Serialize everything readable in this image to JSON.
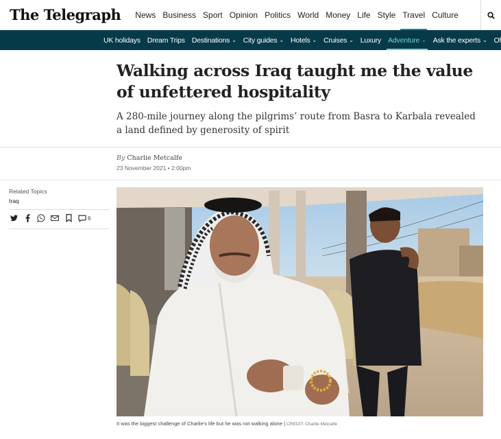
{
  "brand": {
    "logo": "The Telegraph",
    "accent": "#0a8a8a",
    "subnav_bg": "#073a48"
  },
  "main_nav": [
    {
      "label": "News"
    },
    {
      "label": "Business"
    },
    {
      "label": "Sport"
    },
    {
      "label": "Opinion"
    },
    {
      "label": "Politics"
    },
    {
      "label": "World"
    },
    {
      "label": "Money"
    },
    {
      "label": "Life"
    },
    {
      "label": "Style"
    },
    {
      "label": "Travel",
      "active": true
    },
    {
      "label": "Culture"
    }
  ],
  "search_icon": "search-icon",
  "sub_nav": [
    {
      "label": "UK holidays"
    },
    {
      "label": "Dream Trips"
    },
    {
      "label": "Destinations",
      "dropdown": true
    },
    {
      "label": "City guides",
      "dropdown": true
    },
    {
      "label": "Hotels",
      "dropdown": true
    },
    {
      "label": "Cruises",
      "dropdown": true
    },
    {
      "label": "Luxury"
    },
    {
      "label": "Adventure",
      "dropdown": true,
      "active": true
    },
    {
      "label": "Ask the experts",
      "dropdown": true
    },
    {
      "label": "Offers"
    }
  ],
  "article": {
    "headline": "Walking across Iraq taught me the value of unfettered hospitality",
    "standfirst": "A 280-mile journey along the pilgrims’ route from Basra to Karbala revealed a land defined by generosity of spirit",
    "byline_prefix": "By",
    "author": "Charlie Metcalfe",
    "date": "23 November 2021 • 2:00pm",
    "caption": "It was the biggest challenge of Charlie's life but he was not walking alone | ",
    "credit": "CREDIT: Charlie Metcalfe"
  },
  "sidebar": {
    "related_label": "Related Topics",
    "topic": "Iraq",
    "share_icons": [
      "twitter-icon",
      "facebook-icon",
      "whatsapp-icon",
      "email-icon",
      "bookmark-icon",
      "comment-icon"
    ],
    "comment_count": "6"
  }
}
